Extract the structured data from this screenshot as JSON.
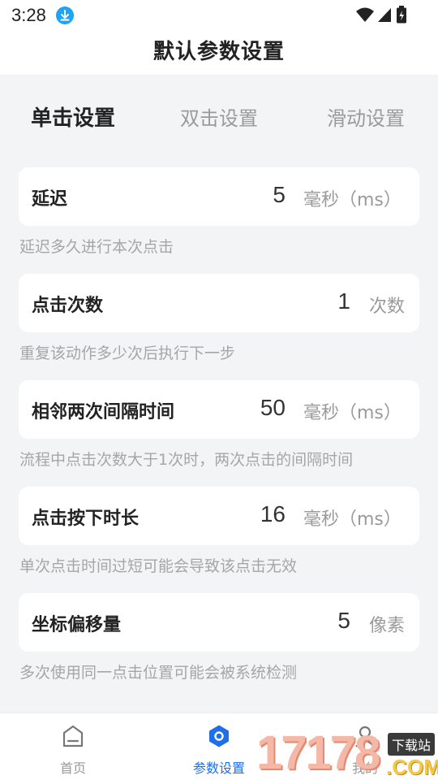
{
  "status_bar": {
    "time": "3:28",
    "icons": [
      "download-icon",
      "wifi-icon",
      "signal-icon",
      "battery-icon"
    ]
  },
  "header": {
    "title": "默认参数设置"
  },
  "tabs": [
    {
      "label": "单击设置",
      "active": true
    },
    {
      "label": "双击设置",
      "active": false
    },
    {
      "label": "滑动设置",
      "active": false
    }
  ],
  "settings": [
    {
      "label": "延迟",
      "value": "5",
      "unit": "毫秒（ms）",
      "description": "延迟多久进行本次点击"
    },
    {
      "label": "点击次数",
      "value": "1",
      "unit": "次数",
      "description": "重复该动作多少次后执行下一步"
    },
    {
      "label": "相邻两次间隔时间",
      "value": "50",
      "unit": "毫秒（ms）",
      "description": "流程中点击次数大于1次时，两次点击的间隔时间"
    },
    {
      "label": "点击按下时长",
      "value": "16",
      "unit": "毫秒（ms）",
      "description": "单次点击时间过短可能会导致该点击无效"
    },
    {
      "label": "坐标偏移量",
      "value": "5",
      "unit": "像素",
      "description": "多次使用同一点击位置可能会被系统检测"
    }
  ],
  "bottom_nav": [
    {
      "label": "首页",
      "icon": "home-icon",
      "active": false
    },
    {
      "label": "参数设置",
      "icon": "settings-hex-icon",
      "active": true
    },
    {
      "label": "我的",
      "icon": "user-icon",
      "active": false
    }
  ],
  "watermark": {
    "digits": "17178",
    "badge": "下载站",
    "suffix": ".COM"
  },
  "colors": {
    "accent": "#1e6fe8",
    "download_badge": "#1fa3f4",
    "page_bg": "#f3f4f6"
  }
}
